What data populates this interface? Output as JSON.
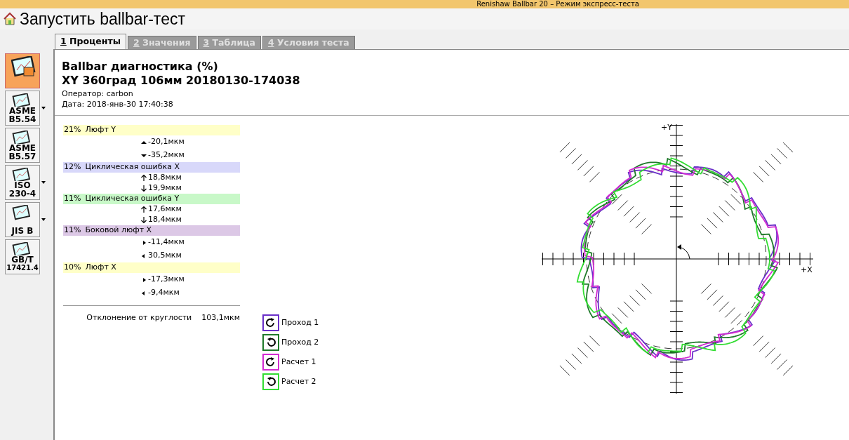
{
  "window": {
    "title": "Renishaw Ballbar 20 – Режим экспресс-теста"
  },
  "header": {
    "title": "Запустить ballbar-тест"
  },
  "sidebar": {
    "items": [
      {
        "kind": "report",
        "selected": true,
        "has_menu": false
      },
      {
        "kind": "standard",
        "lines": [
          "ASME",
          "B5.54"
        ],
        "selected": false,
        "has_menu": true
      },
      {
        "kind": "standard",
        "lines": [
          "ASME",
          "B5.57"
        ],
        "selected": false,
        "has_menu": false
      },
      {
        "kind": "standard",
        "lines": [
          "ISO",
          "230-4"
        ],
        "selected": false,
        "has_menu": true
      },
      {
        "kind": "standard",
        "lines": [
          "JIS B"
        ],
        "selected": false,
        "has_menu": true
      },
      {
        "kind": "standard",
        "lines": [
          "GB/T",
          "17421.4"
        ],
        "selected": false,
        "has_menu": false
      }
    ]
  },
  "tabs": [
    {
      "key": "1",
      "label": "Проценты",
      "selected": true
    },
    {
      "key": "2",
      "label": "Значения",
      "selected": false
    },
    {
      "key": "3",
      "label": "Таблица",
      "selected": false
    },
    {
      "key": "4",
      "label": "Условия теста",
      "selected": false
    }
  ],
  "report": {
    "title": "Ballbar диагностика (%)",
    "subtitle": "XY 360град 106мм 20180130-174038",
    "operator": "Оператор: carbon",
    "date": "Дата: 2018-янв-30 17:40:38"
  },
  "diagnostics": [
    {
      "percent": "21%",
      "label": "Люфт Y",
      "color": "#ffffc8",
      "readings": [
        {
          "kind": "tri_up",
          "text": "-20,1мкм"
        },
        {
          "kind": "tri_down",
          "text": "-35,2мкм"
        }
      ]
    },
    {
      "percent": "12%",
      "label": "Циклическая ошибка X",
      "color": "#d8d8fa",
      "readings": [
        {
          "kind": "arrow_up",
          "text": "18,8мкм"
        },
        {
          "kind": "arrow_down",
          "text": "19,9мкм"
        }
      ]
    },
    {
      "percent": "11%",
      "label": "Циклическая ошибка Y",
      "color": "#c8f8c8",
      "readings": [
        {
          "kind": "arrow_up",
          "text": "17,6мкм"
        },
        {
          "kind": "arrow_down",
          "text": "18,4мкм"
        }
      ]
    },
    {
      "percent": "11%",
      "label": "Боковой люфт X",
      "color": "#dcc8e6",
      "readings": [
        {
          "kind": "tri_right",
          "text": "-11,4мкм"
        },
        {
          "kind": "tri_left",
          "text": "30,5мкм"
        }
      ]
    },
    {
      "percent": "10%",
      "label": "Люфт X",
      "color": "#ffffc8",
      "readings": [
        {
          "kind": "tri_right",
          "text": "-17,3мкм"
        },
        {
          "kind": "tri_left",
          "text": "-9,4мкм"
        }
      ]
    }
  ],
  "roundness": {
    "label": "Отклонение от круглости",
    "value": "103,1мкм"
  },
  "legend": [
    {
      "label": "Проход 1",
      "color": "#6a2fc8",
      "kind": "ccw"
    },
    {
      "label": "Проход 2",
      "color": "#1f7a2a",
      "kind": "cw"
    },
    {
      "label": "Расчет 1",
      "color": "#d22cd2",
      "kind": "ccw"
    },
    {
      "label": "Расчет 2",
      "color": "#33dd33",
      "kind": "cw"
    }
  ],
  "plot": {
    "y_label": "+Y",
    "x_label": "+X"
  }
}
